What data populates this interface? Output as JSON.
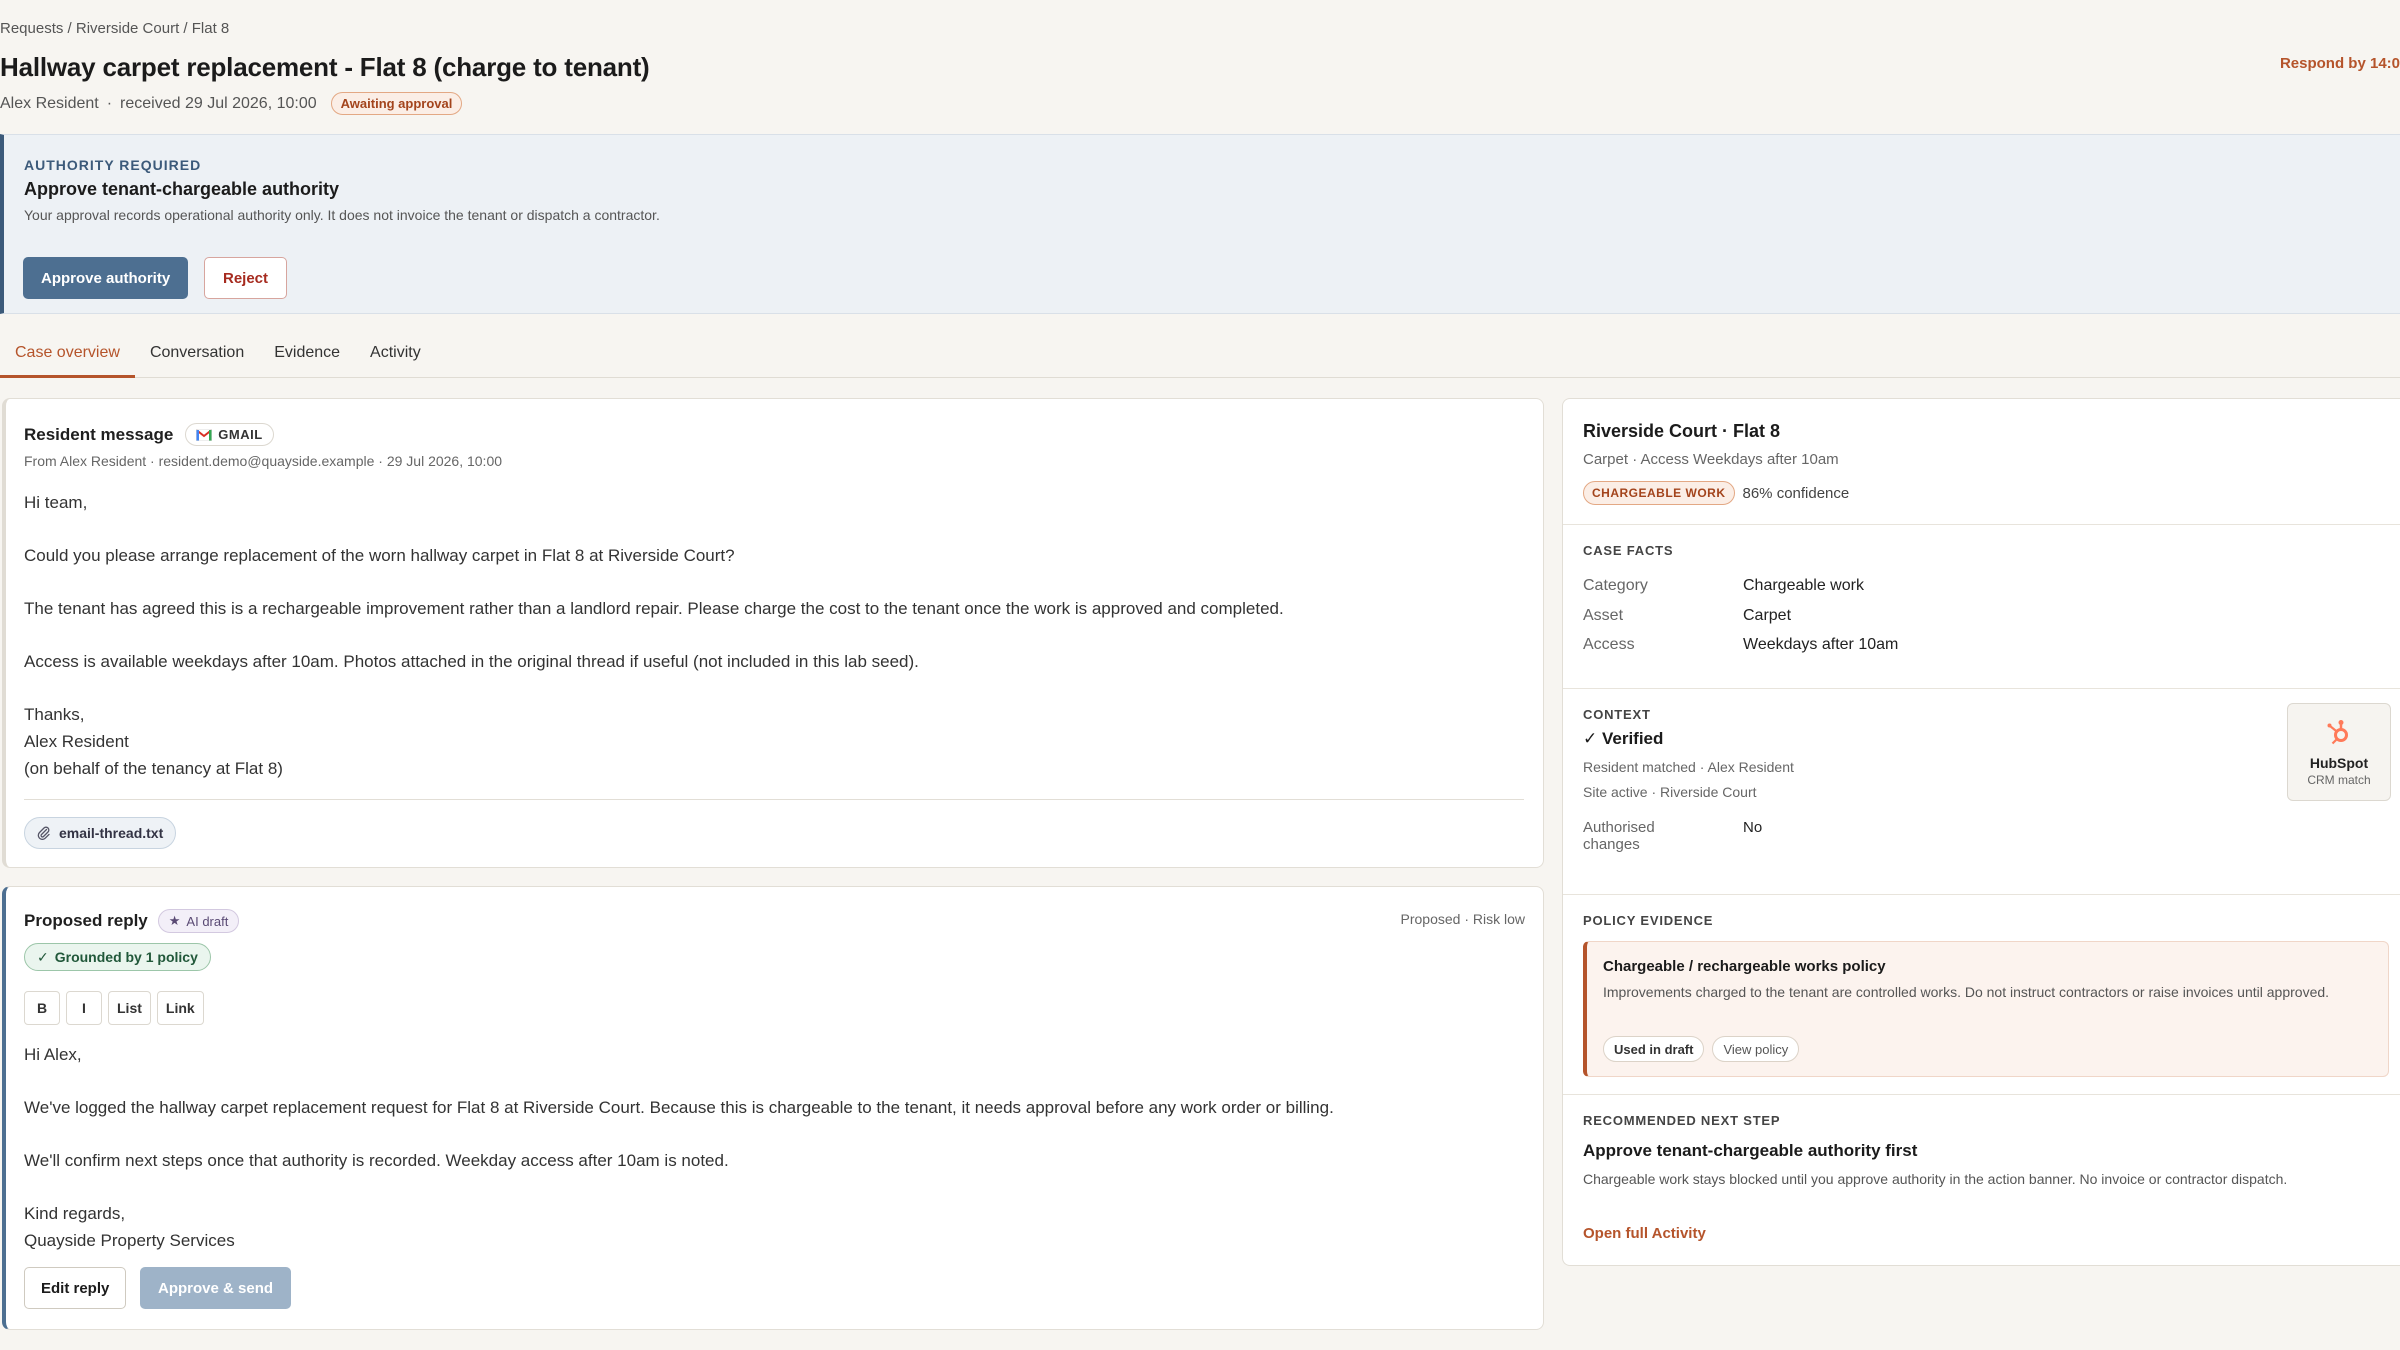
{
  "header": {
    "breadcrumb": "Requests / Riverside Court / Flat 8",
    "title": "Hallway carpet replacement - Flat 8 (charge to tenant)",
    "respond_by": "Respond by 14:0",
    "resident_name": "Alex Resident",
    "separator": "·",
    "received": "received 29 Jul 2026, 10:00",
    "status_badge": "Awaiting approval"
  },
  "authority": {
    "kicker": "AUTHORITY REQUIRED",
    "title": "Approve tenant-chargeable authority",
    "description": "Your approval records operational authority only. It does not invoice the tenant or dispatch a contractor.",
    "approve_label": "Approve authority",
    "reject_label": "Reject"
  },
  "tabs": [
    {
      "label": "Case overview",
      "active": true
    },
    {
      "label": "Conversation",
      "active": false
    },
    {
      "label": "Evidence",
      "active": false
    },
    {
      "label": "Activity",
      "active": false
    }
  ],
  "resident_message": {
    "title": "Resident message",
    "source_badge": "GMAIL",
    "from_line": "From Alex Resident · resident.demo@quayside.example · 29 Jul 2026, 10:00",
    "greeting": "Hi team,",
    "para1": "Could you please arrange replacement of the worn hallway carpet in Flat 8 at Riverside Court?",
    "para2": "The tenant has agreed this is a rechargeable improvement rather than a landlord repair. Please charge the cost to the tenant once the work is approved and completed.",
    "para3": "Access is available weekdays after 10am. Photos attached in the original thread if useful (not included in this lab seed).",
    "signoff1": "Thanks,",
    "signoff2": "Alex Resident",
    "signoff3": "(on behalf of the tenancy at Flat 8)",
    "attachment": "email-thread.txt"
  },
  "proposed_reply": {
    "title": "Proposed reply",
    "ai_badge": "AI draft",
    "status": "Proposed · Risk low",
    "grounded": "Grounded by 1 policy",
    "toolbar": {
      "bold": "B",
      "italic": "I",
      "list": "List",
      "link": "Link"
    },
    "greeting": "Hi Alex,",
    "para1": "We've logged the hallway carpet replacement request for Flat 8 at Riverside Court. Because this is chargeable to the tenant, it needs approval before any work order or billing.",
    "para2": "We'll confirm next steps once that authority is recorded. Weekday access after 10am is noted.",
    "signoff1": "Kind regards,",
    "signoff2": "Quayside Property Services",
    "edit_label": "Edit reply",
    "send_label": "Approve & send"
  },
  "side": {
    "property": "Riverside Court · Flat 8",
    "subline": "Carpet · Access Weekdays after 10am",
    "chip": "CHARGEABLE WORK",
    "confidence": "86% confidence",
    "facts_kicker": "CASE FACTS",
    "facts": [
      {
        "label": "Category",
        "value": "Chargeable work"
      },
      {
        "label": "Asset",
        "value": "Carpet"
      },
      {
        "label": "Access",
        "value": "Weekdays after 10am"
      }
    ],
    "context_kicker": "CONTEXT",
    "verified": "✓ Verified",
    "resident_matched": "Resident matched · Alex Resident",
    "site_active": "Site active · Riverside Court",
    "authorised_label_1": "Authorised",
    "authorised_label_2": "changes",
    "authorised_value": "No",
    "hubspot_name": "HubSpot",
    "hubspot_sub": "CRM match",
    "policy_kicker": "POLICY EVIDENCE",
    "policy_title": "Chargeable / rechargeable works policy",
    "policy_desc": "Improvements charged to the tenant are controlled works. Do not instruct contractors or raise invoices until approved.",
    "policy_used": "Used in draft",
    "policy_view": "View policy",
    "next_kicker": "RECOMMENDED NEXT STEP",
    "next_title": "Approve tenant-chargeable authority first",
    "next_desc": "Chargeable work stays blocked until you approve authority in the action banner. No invoice or contractor dispatch.",
    "next_link": "Open full Activity"
  },
  "colors": {
    "accent": "#b5542b",
    "primary": "#4d6f91",
    "verified_green": "#21583a"
  }
}
